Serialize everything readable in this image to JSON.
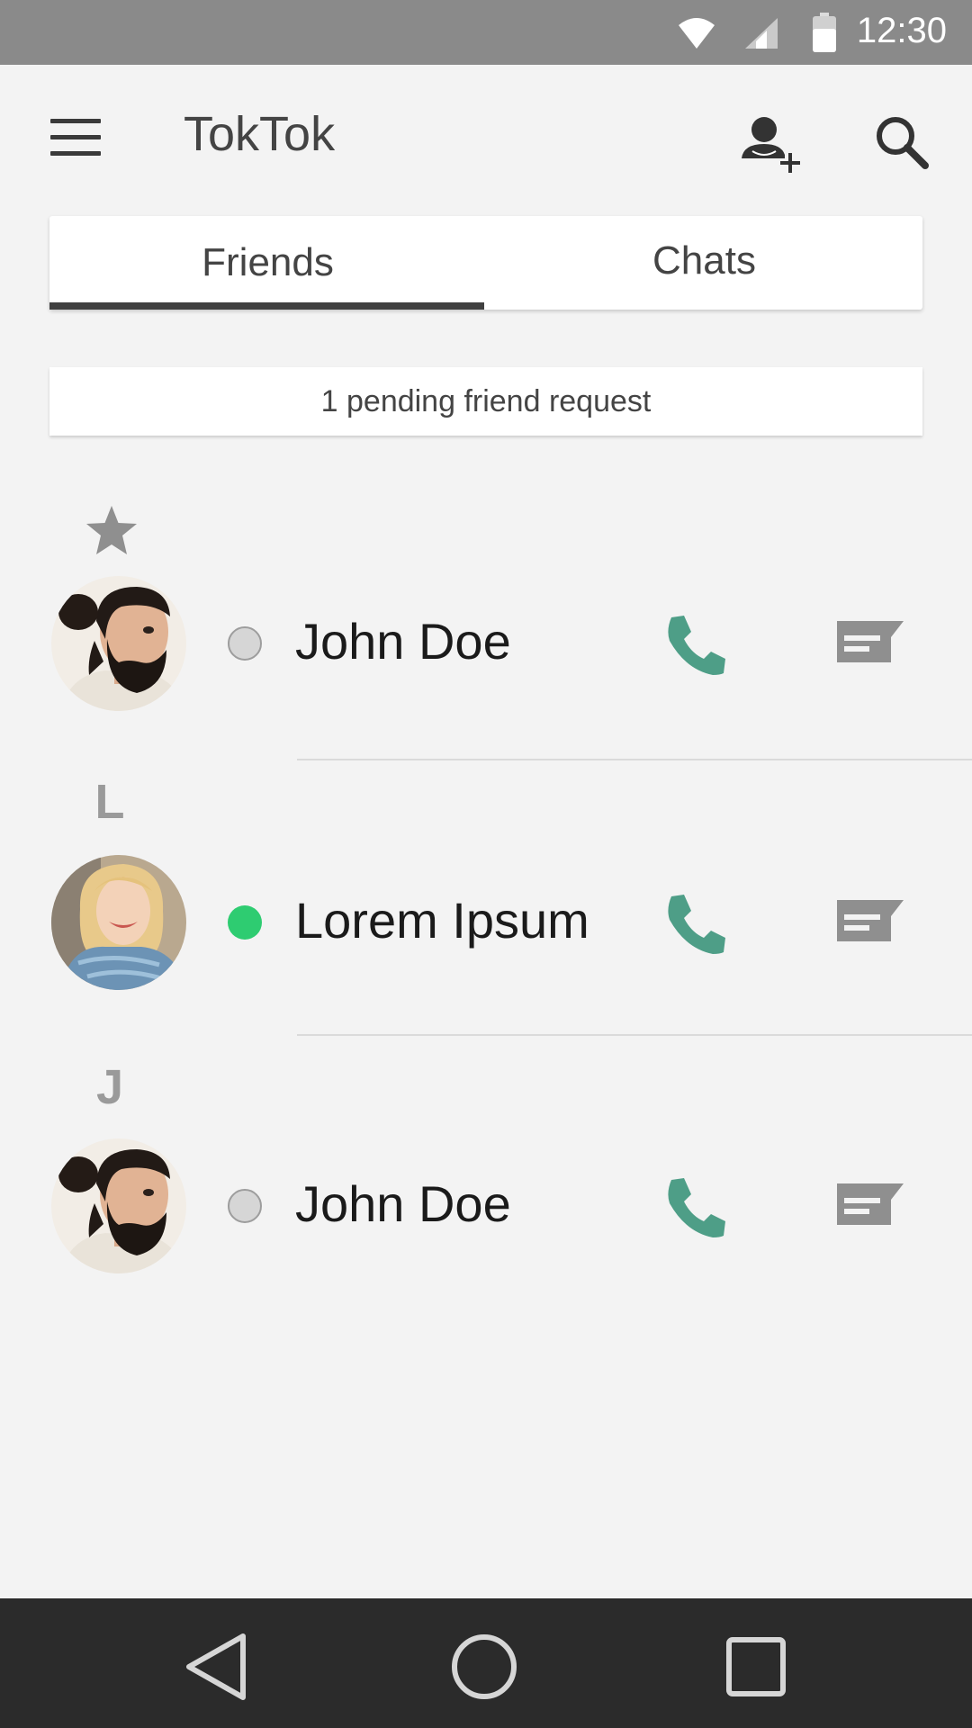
{
  "status_bar": {
    "time": "12:30",
    "icons": [
      "wifi-icon",
      "cell-signal-icon",
      "battery-icon"
    ]
  },
  "app_bar": {
    "title": "TokTok",
    "menu_icon": "hamburger-menu-icon",
    "add_friend_icon": "add-person-icon",
    "search_icon": "search-icon"
  },
  "tabs": [
    {
      "label": "Friends",
      "selected": true
    },
    {
      "label": "Chats",
      "selected": false
    }
  ],
  "pending_requests": {
    "text": "1 pending friend request"
  },
  "sections": [
    {
      "header": "★",
      "header_icon": "star-icon",
      "friends": [
        {
          "name": "John Doe",
          "status": "offline",
          "avatar": "bearded-man"
        }
      ]
    },
    {
      "header": "L",
      "friends": [
        {
          "name": "Lorem Ipsum",
          "status": "online",
          "avatar": "blonde-woman"
        }
      ]
    },
    {
      "header": "J",
      "friends": [
        {
          "name": "John Doe",
          "status": "offline",
          "avatar": "bearded-man"
        }
      ]
    }
  ],
  "colors": {
    "status_bar": "#8a8a8a",
    "background": "#f3f3f3",
    "call_icon": "#4e9e87",
    "message_icon": "#8f8f8f",
    "online": "#2ecc71",
    "offline": "#d6d6d6",
    "nav_bar": "#2b2b2b"
  },
  "nav_bar": {
    "icons": [
      "back-icon",
      "home-icon",
      "recents-icon"
    ]
  }
}
